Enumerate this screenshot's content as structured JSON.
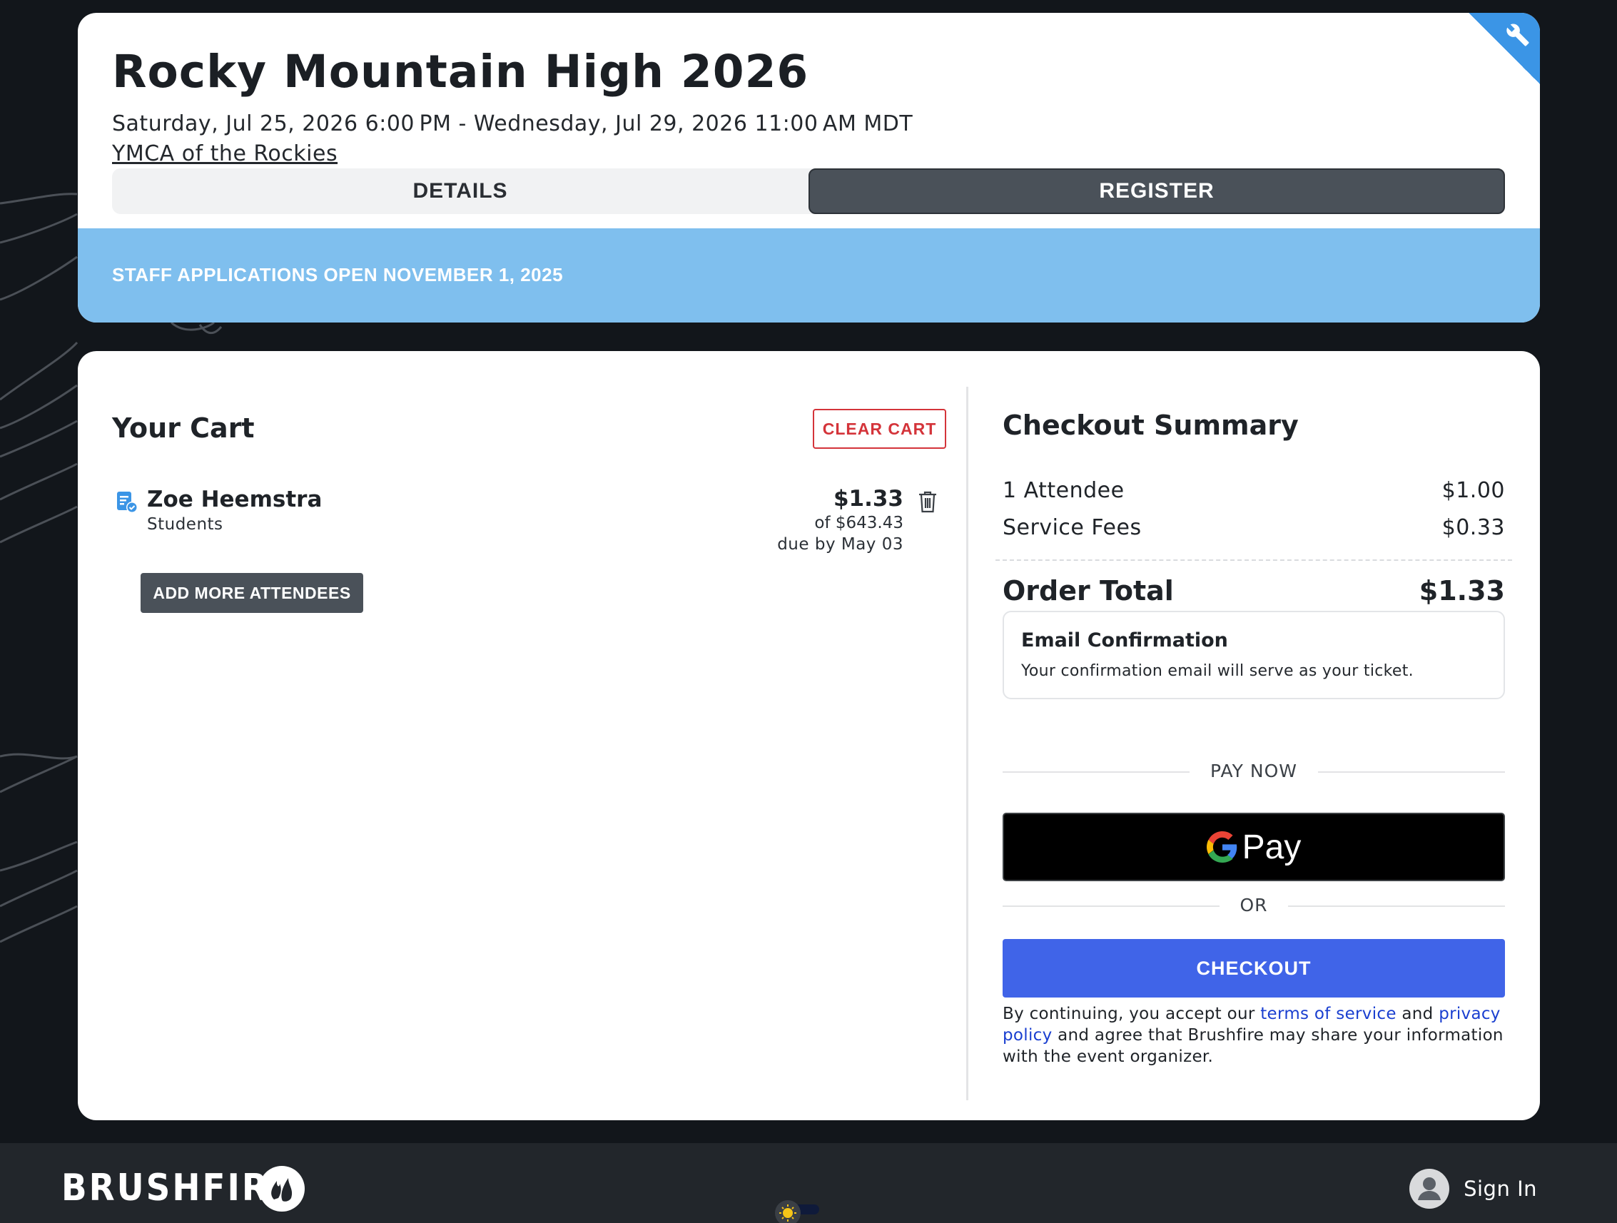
{
  "event": {
    "title": "Rocky Mountain High 2026",
    "dates": "Saturday, Jul 25, 2026 6:00 PM - Wednesday, Jul 29, 2026 11:00 AM MDT",
    "venue": "YMCA of the Rockies",
    "tabs": {
      "details": "DETAILS",
      "register": "REGISTER"
    },
    "announcement": "STAFF APPLICATIONS OPEN NOVEMBER 1, 2025"
  },
  "cart": {
    "title": "Your Cart",
    "clear_label": "CLEAR CART",
    "items": [
      {
        "name": "Zoe Heemstra",
        "type": "Students",
        "amount": "$1.33",
        "of_total": "of $643.43",
        "due": "due by May 03"
      }
    ],
    "add_more_label": "ADD MORE ATTENDEES"
  },
  "summary": {
    "title": "Checkout Summary",
    "rows": [
      {
        "label": "1 Attendee",
        "value": "$1.00"
      },
      {
        "label": "Service Fees",
        "value": "$0.33"
      }
    ],
    "total_label": "Order Total",
    "total_value": "$1.33",
    "email_title": "Email Confirmation",
    "email_text": "Your confirmation email will serve as your ticket.",
    "pay_now_label": "PAY NOW",
    "gpay_label": "Pay",
    "or_label": "OR",
    "checkout_label": "CHECKOUT",
    "legal": {
      "prefix": "By continuing, you accept our ",
      "terms_link": "terms of service",
      "and": " and ",
      "privacy_link": "privacy policy",
      "suffix": " and agree that Brushfire may share your information with the event organizer."
    }
  },
  "footer": {
    "brand": "BRUSHFIRE",
    "signin_label": "Sign In"
  },
  "colors": {
    "page_bg": "#12161b",
    "announcement_bg": "#7fbfee",
    "checkout_bg": "#4064e8",
    "clear_cart": "#d4343a",
    "dark_button": "#4a5159"
  },
  "icons": [
    "wrench-icon",
    "registration-icon",
    "trash-icon",
    "google-g-icon",
    "brushfire-flame-icon",
    "sun-icon",
    "user-avatar-icon"
  ]
}
